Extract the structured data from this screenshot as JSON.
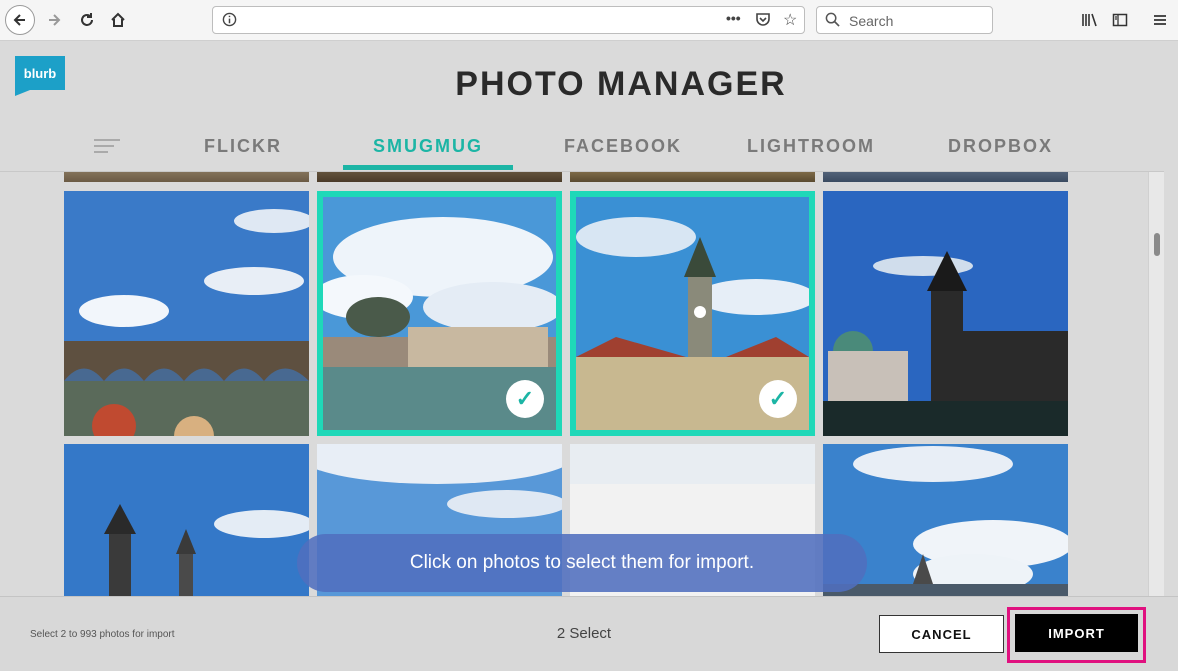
{
  "browser": {
    "search_placeholder": "Search",
    "icons": [
      "back-icon",
      "forward-icon",
      "reload-icon",
      "home-icon",
      "info-icon",
      "more-icon",
      "pocket-icon",
      "star-icon",
      "search-icon",
      "library-icon",
      "sidebar-icon",
      "hamburger-icon"
    ]
  },
  "app": {
    "logo_text": "blurb",
    "title": "PHOTO MANAGER",
    "tabs": [
      {
        "label": "FLICKR",
        "active": false
      },
      {
        "label": "SMUGMUG",
        "active": true
      },
      {
        "label": "FACEBOOK",
        "active": false
      },
      {
        "label": "LIGHTROOM",
        "active": false
      },
      {
        "label": "DROPBOX",
        "active": false
      }
    ]
  },
  "photos": [
    {
      "label": "Charles Bridge with people in foreground",
      "selected": false
    },
    {
      "label": "National Theatre across river",
      "selected": true
    },
    {
      "label": "Tower with clock above buildings",
      "selected": true
    },
    {
      "label": "Domes and gothic tower at bridge",
      "selected": false
    },
    {
      "label": "Gothic towers under sky",
      "selected": false
    },
    {
      "label": "Cloudy sky",
      "selected": false
    },
    {
      "label": "Bright sky",
      "selected": false
    },
    {
      "label": "Castle on hill with clouds",
      "selected": false
    }
  ],
  "toast": {
    "message": "Click on photos to select them for import."
  },
  "footer": {
    "hint": "Select 2 to 993 photos for import",
    "select_count": "2 Select",
    "cancel_label": "CANCEL",
    "import_label": "IMPORT"
  },
  "colors": {
    "accent": "#1cb5a5",
    "selection": "#1fd8b8",
    "highlight": "#e0117f",
    "logo": "#1ca0c8"
  }
}
